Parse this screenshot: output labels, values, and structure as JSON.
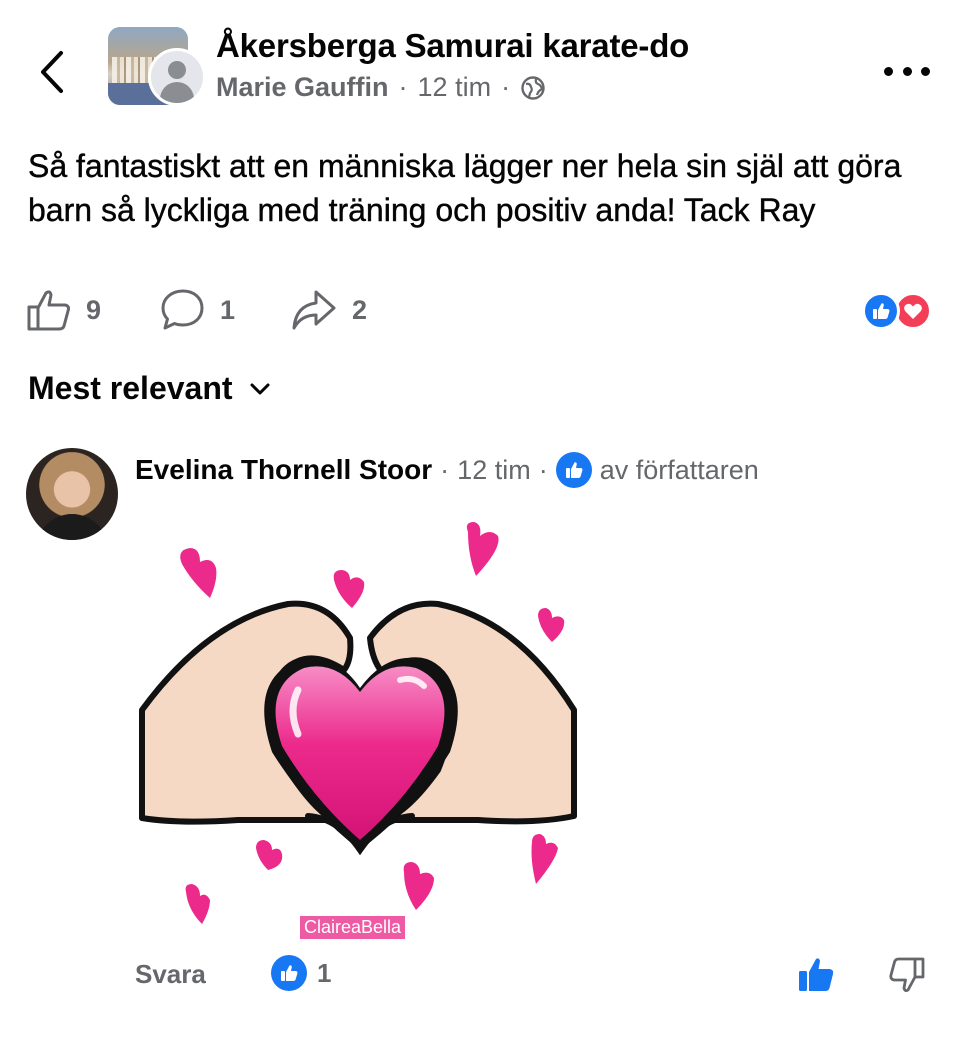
{
  "header": {
    "group_name": "Åkersberga Samurai karate-do",
    "author": "Marie Gauffin",
    "time": "12 tim",
    "separator": "·",
    "icons": {
      "back": "chevron-left-icon",
      "privacy": "globe-icon",
      "more": "more-dots-icon"
    }
  },
  "post": {
    "text": "Så fantastiskt att en människa lägger ner hela sin själ att göra barn så lyckliga med träning och positiv anda! Tack Ray"
  },
  "actions": {
    "likes": "9",
    "comments": "1",
    "shares": "2",
    "reactions": [
      "like",
      "love"
    ]
  },
  "sort": {
    "label": "Mest relevant"
  },
  "comment": {
    "name": "Evelina Thornell Stoor",
    "time": "12 tim",
    "separator": "·",
    "author_like": "av författaren",
    "sticker_tag": "ClaireaBella",
    "reply": "Svara",
    "like_count": "1"
  },
  "colors": {
    "accent": "#1877f2",
    "love": "#f33e58",
    "secondary_text": "#65676b",
    "sticker_pink": "#ec2a8c"
  }
}
